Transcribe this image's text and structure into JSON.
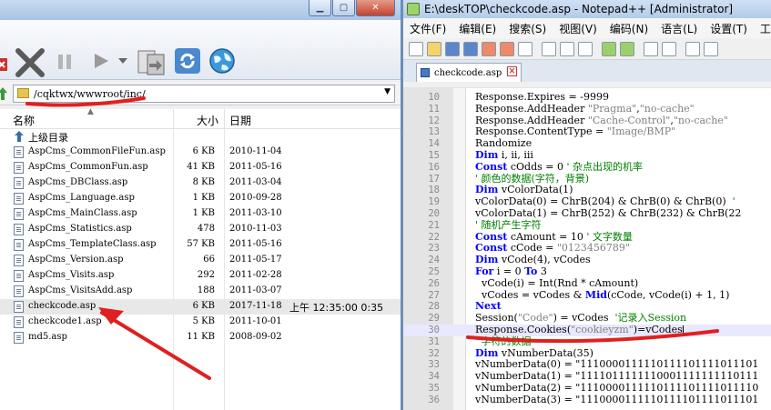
{
  "left": {
    "address": "/cqktwx/wwwroot/inc/",
    "columns": [
      "名称",
      "大小",
      "日期"
    ],
    "parent_label": "上级目录",
    "files": [
      {
        "name": "AspCms_CommonFileFun.asp",
        "size": "6 KB",
        "date": "2010-11-04",
        "time": ""
      },
      {
        "name": "AspCms_CommonFun.asp",
        "size": "41 KB",
        "date": "2011-05-16",
        "time": ""
      },
      {
        "name": "AspCms_DBClass.asp",
        "size": "8 KB",
        "date": "2011-03-04",
        "time": ""
      },
      {
        "name": "AspCms_Language.asp",
        "size": "1 KB",
        "date": "2010-09-28",
        "time": ""
      },
      {
        "name": "AspCms_MainClass.asp",
        "size": "1 KB",
        "date": "2011-03-10",
        "time": ""
      },
      {
        "name": "AspCms_Statistics.asp",
        "size": "478",
        "date": "2010-11-03",
        "time": ""
      },
      {
        "name": "AspCms_TemplateClass.asp",
        "size": "57 KB",
        "date": "2011-05-16",
        "time": ""
      },
      {
        "name": "AspCms_Version.asp",
        "size": "66",
        "date": "2011-05-17",
        "time": ""
      },
      {
        "name": "AspCms_Visits.asp",
        "size": "292",
        "date": "2011-02-28",
        "time": ""
      },
      {
        "name": "AspCms_VisitsAdd.asp",
        "size": "188",
        "date": "2011-03-07",
        "time": ""
      },
      {
        "name": "checkcode.asp",
        "size": "6 KB",
        "date": "2017-11-18",
        "time": "上午 12:35:00 0:35"
      },
      {
        "name": "checkcode1.asp",
        "size": "5 KB",
        "date": "2011-10-01",
        "time": ""
      },
      {
        "name": "md5.asp",
        "size": "11 KB",
        "date": "2008-09-02",
        "time": ""
      }
    ],
    "selected_index": 10
  },
  "right": {
    "title": "E:\\deskTOP\\checkcode.asp - Notepad++ [Administrator]",
    "menus": [
      "文件(F)",
      "编辑(E)",
      "搜索(S)",
      "视图(V)",
      "编码(N)",
      "语言(L)",
      "设置(T)",
      "工具"
    ],
    "tab_label": "checkcode.asp",
    "current_line": 30,
    "lines": [
      {
        "n": "10",
        "code": "  Response.Expires = -9999"
      },
      {
        "n": "11",
        "code": "  Response.AddHeader \"Pragma\",\"no-cache\""
      },
      {
        "n": "12",
        "code": "  Response.AddHeader \"Cache-Control\",\"no-cache\""
      },
      {
        "n": "13",
        "code": "  Response.ContentType = \"Image/BMP\""
      },
      {
        "n": "14",
        "code": "  Randomize"
      },
      {
        "n": "15",
        "code": "  Dim i, ii, iii"
      },
      {
        "n": "16",
        "code": "  Const cOdds = 0 ' 杂点出现的机率"
      },
      {
        "n": "17",
        "code": "  ' 颜色的数据(字符，背景)"
      },
      {
        "n": "18",
        "code": "  Dim vColorData(1)"
      },
      {
        "n": "19",
        "code": "  vColorData(0) = ChrB(204) & ChrB(0) & ChrB(0)  '"
      },
      {
        "n": "20",
        "code": "  vColorData(1) = ChrB(252) & ChrB(232) & ChrB(22"
      },
      {
        "n": "21",
        "code": "  ' 随机产生字符"
      },
      {
        "n": "22",
        "code": "  Const cAmount = 10 ' 文字数量"
      },
      {
        "n": "23",
        "code": "  Const cCode = \"0123456789\""
      },
      {
        "n": "24",
        "code": "  Dim vCode(4), vCodes"
      },
      {
        "n": "25",
        "code": "  For i = 0 To 3"
      },
      {
        "n": "26",
        "code": "    vCode(i) = Int(Rnd * cAmount)"
      },
      {
        "n": "27",
        "code": "    vCodes = vCodes & Mid(cCode, vCode(i) + 1, 1)"
      },
      {
        "n": "28",
        "code": "  Next"
      },
      {
        "n": "29",
        "code": "  Session(\"Code\") = vCodes  '记录入Session"
      },
      {
        "n": "30",
        "code": "  Response.Cookies(\"cookieyzm\")=vCodes"
      },
      {
        "n": "31",
        "code": "  ' 字符的数据"
      },
      {
        "n": "32",
        "code": "  Dim vNumberData(35)"
      },
      {
        "n": "33",
        "code": "  vNumberData(0) = \"1110000111110111101111011101"
      },
      {
        "n": "34",
        "code": "  vNumberData(1) = \"1111011111110001111111110111"
      },
      {
        "n": "35",
        "code": "  vNumberData(2) = \"1110000111110111101111011110"
      },
      {
        "n": "36",
        "code": "  vNumberData(3) = \"1110000111110111101111011101"
      }
    ]
  },
  "colors": {
    "keyword": "#0000ff",
    "string": "#808080",
    "comment": "#008000",
    "annotation": "#e02020"
  }
}
